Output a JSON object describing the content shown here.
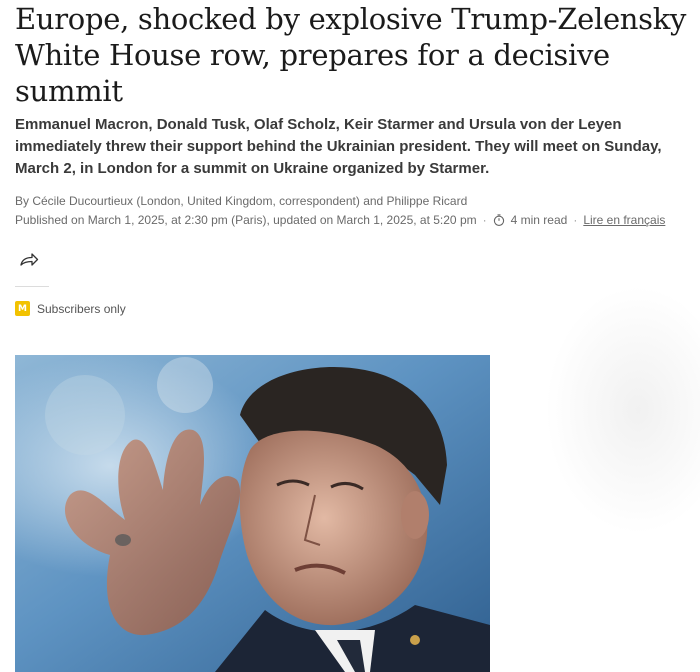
{
  "article": {
    "headline": "Europe, shocked by explosive Trump-Zelensky White House row, prepares for a decisive summit",
    "subheadline": "Emmanuel Macron, Donald Tusk, Olaf Scholz, Keir Starmer and Ursula von der Leyen immediately threw their support behind the Ukrainian president. They will meet on Sunday, March 2, in London for a summit on Ukraine organized by Starmer.",
    "byline": "By Cécile Ducourtieux (London, United Kingdom, correspondent) and Philippe Ricard",
    "published": "Published on March 1, 2025, at 2:30 pm (Paris), updated on March 1, 2025, at 5:20 pm",
    "read_time": "4 min read",
    "french_link": "Lire en français",
    "separator": "·"
  },
  "access": {
    "badge_text": "M",
    "label": "Subscribers only",
    "badge_color": "#f2c200"
  },
  "icons": {
    "share": "share-icon",
    "timer": "timer-icon"
  }
}
